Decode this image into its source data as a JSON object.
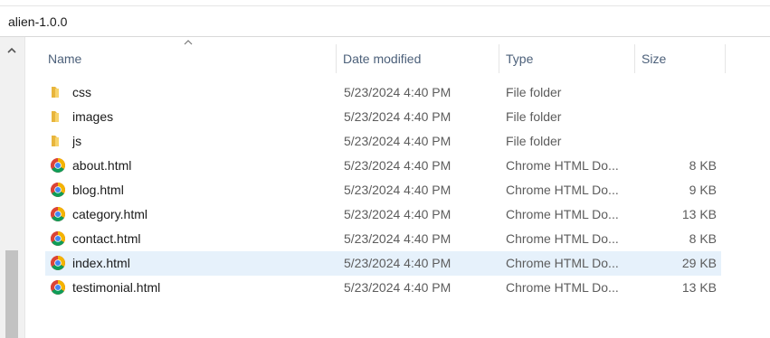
{
  "window": {
    "address": "alien-1.0.0"
  },
  "columns": {
    "name": "Name",
    "date": "Date modified",
    "type": "Type",
    "size": "Size"
  },
  "rows": [
    {
      "name": "css",
      "date": "5/23/2024 4:40 PM",
      "type": "File folder",
      "size": "",
      "icon": "folder-icon"
    },
    {
      "name": "images",
      "date": "5/23/2024 4:40 PM",
      "type": "File folder",
      "size": "",
      "icon": "folder-icon"
    },
    {
      "name": "js",
      "date": "5/23/2024 4:40 PM",
      "type": "File folder",
      "size": "",
      "icon": "folder-icon"
    },
    {
      "name": "about.html",
      "date": "5/23/2024 4:40 PM",
      "type": "Chrome HTML Do...",
      "size": "8 KB",
      "icon": "chrome-icon"
    },
    {
      "name": "blog.html",
      "date": "5/23/2024 4:40 PM",
      "type": "Chrome HTML Do...",
      "size": "9 KB",
      "icon": "chrome-icon"
    },
    {
      "name": "category.html",
      "date": "5/23/2024 4:40 PM",
      "type": "Chrome HTML Do...",
      "size": "13 KB",
      "icon": "chrome-icon"
    },
    {
      "name": "contact.html",
      "date": "5/23/2024 4:40 PM",
      "type": "Chrome HTML Do...",
      "size": "8 KB",
      "icon": "chrome-icon"
    },
    {
      "name": "index.html",
      "date": "5/23/2024 4:40 PM",
      "type": "Chrome HTML Do...",
      "size": "29 KB",
      "icon": "chrome-icon",
      "selected": true
    },
    {
      "name": "testimonial.html",
      "date": "5/23/2024 4:40 PM",
      "type": "Chrome HTML Do...",
      "size": "13 KB",
      "icon": "chrome-icon"
    }
  ],
  "colors": {
    "selection": "#e6f1fb",
    "header_text": "#4c607a",
    "folder": "#f2c94c"
  }
}
